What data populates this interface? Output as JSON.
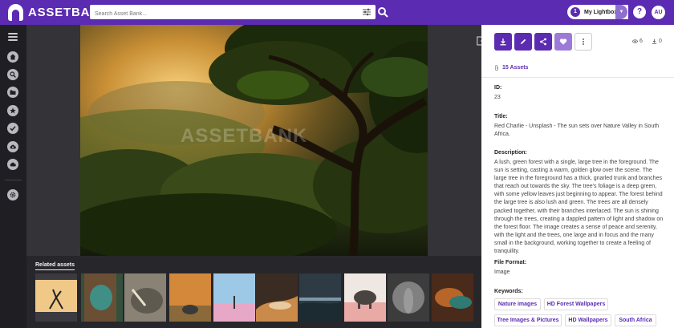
{
  "header": {
    "logo_text": "ASSETBANK",
    "search_placeholder": "Search Asset Bank...",
    "lightbox_count": "1",
    "lightbox_label": "My Lightbox",
    "help_label": "?",
    "avatar_initials": "AU",
    "colors": {
      "brand": "#5b2bb1",
      "accent_light": "#8e6fd0"
    }
  },
  "sidebar": {
    "items": [
      {
        "icon": "home-icon"
      },
      {
        "icon": "search-icon"
      },
      {
        "icon": "folder-icon"
      },
      {
        "icon": "star-icon"
      },
      {
        "icon": "check-icon"
      },
      {
        "icon": "upload-cloud-icon"
      },
      {
        "icon": "cloud-icon"
      },
      {
        "icon": "settings-icon"
      }
    ]
  },
  "viewer": {
    "watermark": "ASSETBANK"
  },
  "related": {
    "title": "Related assets",
    "count": 10
  },
  "panel": {
    "actions": [
      "download-icon",
      "edit-icon",
      "share-icon",
      "heart-icon",
      "more-vertical-icon"
    ],
    "views": "6",
    "downloads": "0",
    "assets_link": "15 Assets",
    "id_label": "ID:",
    "id_value": "23",
    "title_label": "Title:",
    "title_value": "Red Charlie - Unsplash - The sun sets over Nature Valley in South Africa.",
    "description_label": "Description:",
    "description_value": "A lush, green forest with a single, large tree in the foreground. The sun is setting, casting a warm, golden glow over the scene. The large tree in the foreground has a thick, gnarled trunk and branches that reach out towards the sky. The tree's foliage is a deep green, with some yellow leaves just beginning to appear. The forest behind the large tree is also lush and green. The trees are all densely packed together, with their branches interlaced. The sun is shining through the trees, creating a dappled pattern of light and shadow on the forest floor. The image creates a sense of peace and serenity, with the light and the trees, one large and in focus and the many small in the background, working together to create a feeling of tranquility.",
    "format_label": "File Format:",
    "format_value": "Image",
    "keywords_label": "Keywords:",
    "keywords": [
      "Nature images",
      "HD Forest Wallpapers",
      "Tree Images & Pictures",
      "HD Wallpapers",
      "South Africa"
    ]
  }
}
